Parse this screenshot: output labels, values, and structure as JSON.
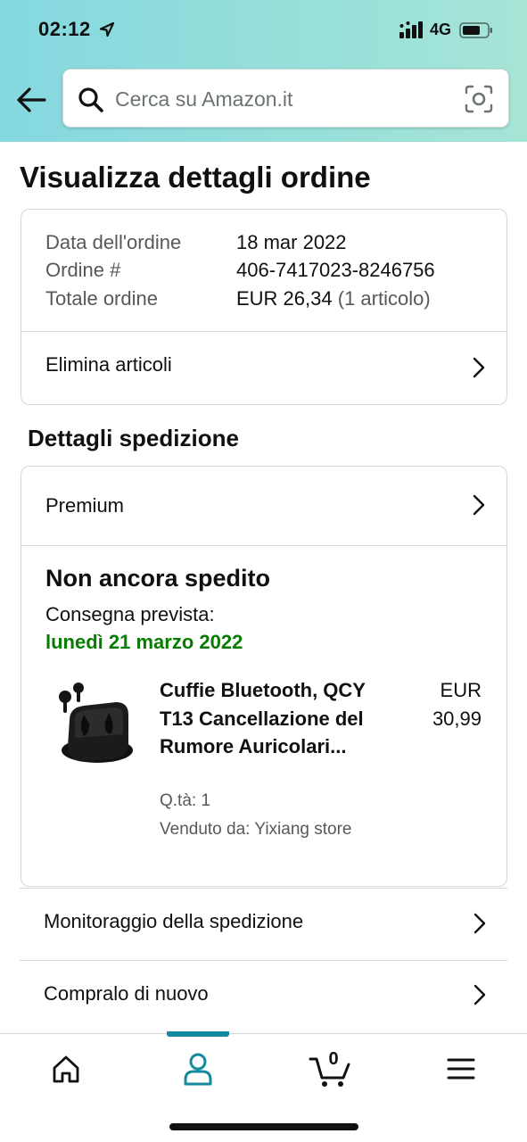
{
  "status_bar": {
    "time": "02:12",
    "network": "4G"
  },
  "search": {
    "placeholder": "Cerca su Amazon.it"
  },
  "page": {
    "title": "Visualizza dettagli ordine"
  },
  "order_summary": {
    "date_label": "Data dell'ordine",
    "date_value": "18 mar 2022",
    "number_label": "Ordine #",
    "number_value": "406-7417023-8246756",
    "total_label": "Totale ordine",
    "total_value": "EUR 26,34",
    "total_items": "(1 articolo)",
    "delete_items_label": "Elimina articoli"
  },
  "shipping": {
    "section_title": "Dettagli spedizione",
    "method": "Premium",
    "status": "Non ancora spedito",
    "delivery_label": "Consegna prevista:",
    "delivery_date": "lunedì 21 marzo 2022",
    "product": {
      "name": "Cuffie Bluetooth, QCY T13 Cancellazione del Rumore Auricolari...",
      "price_currency": "EUR",
      "price_value": "30,99",
      "quantity": "Q.tà: 1",
      "seller": "Venduto da: Yixiang store"
    }
  },
  "actions": [
    {
      "label": "Monitoraggio della spedizione"
    },
    {
      "label": "Compralo di nuovo"
    }
  ],
  "tab_bar": {
    "cart_count": "0",
    "active_tab": "account",
    "accent_color": "#138a9e"
  },
  "colors": {
    "delivery_green": "#067d00",
    "header_gradient_start": "#84d8e0",
    "header_gradient_end": "#a6e5d6"
  }
}
